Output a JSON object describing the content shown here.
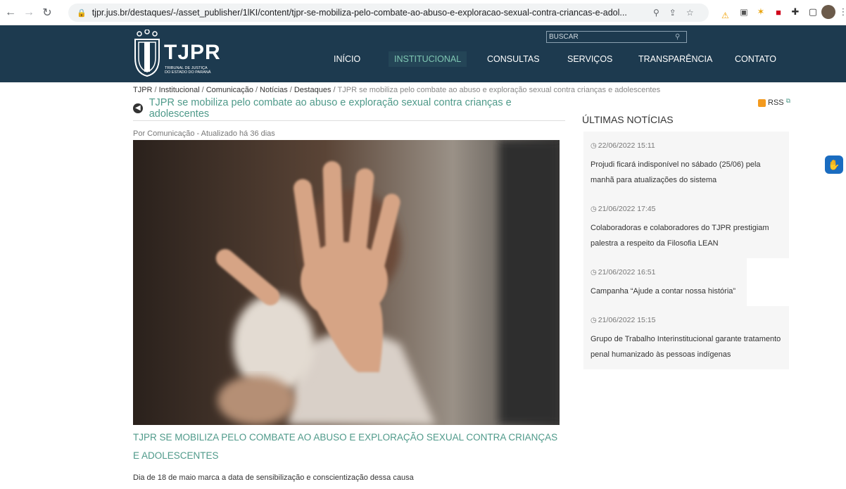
{
  "browser": {
    "url": "tjpr.jus.br/destaques/-/asset_publisher/1lKI/content/tjpr-se-mobiliza-pelo-combate-ao-abuso-e-exploracao-sexual-contra-criancas-e-adol..."
  },
  "site": {
    "logo_name": "TJPR",
    "logo_sub_line1": "Tribunal de Justiça",
    "logo_sub_line2": "do Estado do Paraná",
    "search_placeholder": "BUSCAR",
    "menu": [
      {
        "label": "INÍCIO"
      },
      {
        "label": "INSTITUCIONAL"
      },
      {
        "label": "CONSULTAS"
      },
      {
        "label": "SERVIÇOS"
      },
      {
        "label": "TRANSPARÊNCIA"
      },
      {
        "label": "CONTATO"
      }
    ]
  },
  "breadcrumb": {
    "items": [
      "TJPR",
      "Institucional",
      "Comunicação",
      "Notícias",
      "Destaques"
    ],
    "current": "TJPR se mobiliza pelo combate ao abuso e exploração sexual contra crianças e adolescentes"
  },
  "article": {
    "title": "TJPR se mobiliza pelo combate ao abuso e exploração sexual contra crianças e adolescentes",
    "byline_author": "Por Comunicação",
    "byline_updated": "Atualizado há 36 dias",
    "headline": "TJPR SE MOBILIZA PELO COMBATE AO ABUSO E EXPLORAÇÃO SEXUAL CONTRA CRIANÇAS E ADOLESCENTES",
    "lead": "Dia de 18 de maio marca a data de sensibilização e conscientização dessa causa"
  },
  "sidebar": {
    "rss_label": "RSS",
    "title": "ÚLTIMAS NOTÍCIAS",
    "news": [
      {
        "date": "22/06/2022 15:11",
        "text": "Projudi ficará indisponível no sábado (25/06) pela manhã para atualizações do sistema"
      },
      {
        "date": "21/06/2022 17:45",
        "text": "Colaboradoras e colaboradores do TJPR prestigiam palestra a respeito da Filosofia LEAN"
      },
      {
        "date": "21/06/2022 16:51",
        "text": "Campanha “Ajude a contar nossa história”"
      },
      {
        "date": "21/06/2022 15:15",
        "text": "Grupo de Trabalho Interinstitucional garante tratamento penal humanizado às pessoas indígenas"
      }
    ]
  }
}
